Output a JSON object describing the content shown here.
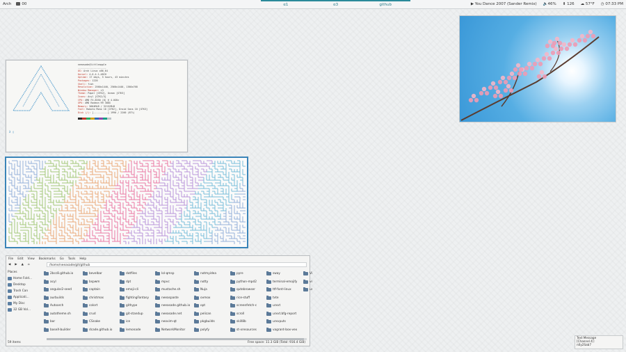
{
  "topbar": {
    "os_label": "Arch",
    "monitor_label": "00",
    "workspaces": [
      "α1",
      "α3",
      "github"
    ],
    "now_playing": "You Dance 2007 (Sander Remix)",
    "volume": "46%",
    "updates": "126",
    "weather": "57°F",
    "clock": "07:33 PM"
  },
  "terminal": {
    "info_lines": [
      [
        "",
        "neeasade@littleapple"
      ],
      [
        "",
        "--------------------"
      ],
      [
        "OS:",
        "Arch Linux x86_64"
      ],
      [
        "Kernel:",
        "4.6.4-1-ARCH"
      ],
      [
        "Uptime:",
        "17 days, 5 hours, 43 minutes"
      ],
      [
        "Packages:",
        "1220"
      ],
      [
        "Shell:",
        "fish"
      ],
      [
        "Resolution:",
        "2560x1440, 2560x1440, 1360x768"
      ],
      [
        "Window Manager:",
        "i3"
      ],
      [
        "Theme:",
        "Paper [GTK2], Ocean [GTK3]"
      ],
      [
        "Icons:",
        "Acyl [GTK2/3]"
      ],
      [
        "CPU:",
        "AMD FX-8350 (8) @ 4.0GHz"
      ],
      [
        "GPU:",
        "AMD Radeon R9 380X"
      ],
      [
        "Memory:",
        "5664MiB / 32152MiB"
      ],
      [
        "Font:",
        "Roboto Mono 10 [GTK2], Droid Sans 10 [GTK3]"
      ],
      [
        "Disk (/):",
        "[----------] 1990 / 2200 (87%)"
      ]
    ],
    "prompt": "λ",
    "swatch_colors": [
      "#2c2c2c",
      "#c0392b",
      "#27ae60",
      "#d4a017",
      "#2e6db4",
      "#8e44ad",
      "#16a085",
      "#bdc3c7"
    ]
  },
  "file_manager": {
    "menus": [
      "File",
      "Edit",
      "View",
      "Bookmarks",
      "Go",
      "Tools",
      "Help"
    ],
    "path": "/home/neeasade/git/github",
    "places_header": "Places",
    "places": [
      "Home Fold...",
      "Desktop",
      "Trash Can",
      "Applicati...",
      "My Disc",
      "32 GB Vol..."
    ],
    "folders": [
      "2bcc8.github.io",
      "acyl",
      "angular2-seed",
      "aurbuilds",
      "Autoarch",
      "autotheme.sh",
      "bar",
      "baseX-builder",
      "bevelbar",
      "bspwm",
      "captain",
      "christmas",
      "colort",
      "crud",
      "CSnake",
      "dcade.github.io",
      "dotfiles",
      "dpt",
      "emoji-cli",
      "fightingFantasy",
      "githype",
      "git-standup",
      "ice",
      "lemonade",
      "lol-qmsp",
      "mpvc",
      "mustache.sh",
      "neeaspaste",
      "neeasade.github.io",
      "neeasade.net",
      "neovim-qt",
      "NetworkMonitor",
      "notmyidea",
      "notty",
      "Nuja",
      "ovmox",
      "opt",
      "pelican",
      "pkgbuilds",
      "polyfy",
      "pyre",
      "python-mpd2",
      "qutebrowser",
      "rice-stuff",
      "screenfetch-c",
      "scroll",
      "skill8b",
      "st-xresources",
      "sway",
      "terminal-emojify",
      "ttf-font-linux",
      "tvte",
      "urxvt",
      "urxvt.bfg-report",
      "urxvputs",
      "vagrant-box-vex",
      "Vimplu",
      "vst",
      "urxv.d"
    ],
    "status_left": "59 items",
    "status_right": "Free space: 11.3 GiB (Total: 916.4 GiB)"
  },
  "notification": {
    "title": "Text Message",
    "line1": "[Channel 4]:",
    "line2": "n0y2Sab7"
  }
}
